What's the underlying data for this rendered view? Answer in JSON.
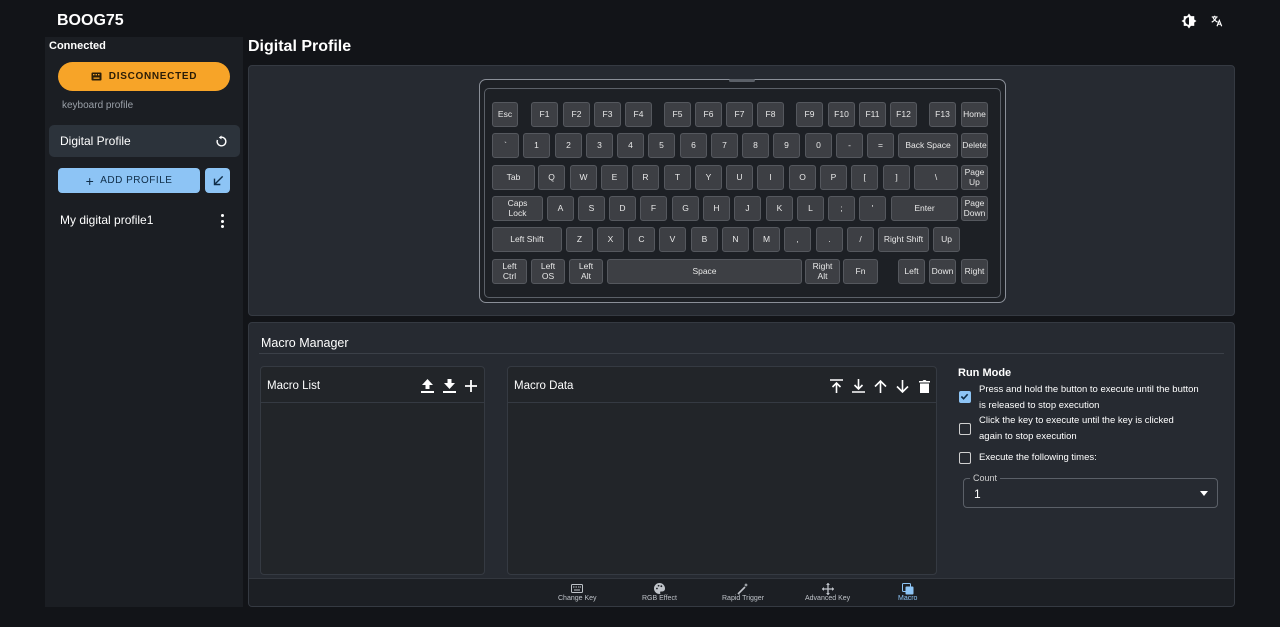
{
  "app": {
    "title": "BOOG75",
    "theme_icon": "brightness-icon",
    "language_icon": "translate-icon"
  },
  "sidebar": {
    "status": "Connected",
    "disconnect_label": "DISCONNECTED",
    "section_label": "keyboard profile",
    "active_profile": "Digital Profile",
    "add_profile_label": "ADD PROFILE",
    "profiles": [
      {
        "name": "My digital profile1"
      }
    ]
  },
  "main": {
    "title": "Digital Profile"
  },
  "keyboard": {
    "keys": [
      "Esc",
      "F1",
      "F2",
      "F3",
      "F4",
      "F5",
      "F6",
      "F7",
      "F8",
      "F9",
      "F10",
      "F11",
      "F12",
      "F13",
      "Home",
      "`",
      "1",
      "2",
      "3",
      "4",
      "5",
      "6",
      "7",
      "8",
      "9",
      "0",
      "-",
      "=",
      "Back Space",
      "Delete",
      "Tab",
      "Q",
      "W",
      "E",
      "R",
      "T",
      "Y",
      "U",
      "I",
      "O",
      "P",
      "[",
      "]",
      "\\",
      "Page\nUp",
      "Caps\nLock",
      "A",
      "S",
      "D",
      "F",
      "G",
      "H",
      "J",
      "K",
      "L",
      ";",
      "'",
      "Enter",
      "Page\nDown",
      "Left Shift",
      "Z",
      "X",
      "C",
      "V",
      "B",
      "N",
      "M",
      ",",
      ".",
      "/",
      "Right Shift",
      "Up",
      "Left\nCtrl",
      "Left\nOS",
      "Left\nAlt",
      "Space",
      "Right\nAlt",
      "Fn",
      "Left",
      "Down",
      "Right"
    ]
  },
  "macro": {
    "title": "Macro Manager",
    "list_title": "Macro List",
    "data_title": "Macro Data",
    "run_mode_title": "Run Mode",
    "options": [
      {
        "label": "Press and hold the button to execute until the button is released to stop execution",
        "checked": true
      },
      {
        "label": "Click the key to execute until the key is clicked again to stop execution",
        "checked": false
      },
      {
        "label": "Execute the following times:",
        "checked": false
      }
    ],
    "count_label": "Count",
    "count_value": "1"
  },
  "bottom_nav": {
    "items": [
      {
        "label": "Change Key",
        "icon": "keyboard-icon"
      },
      {
        "label": "RGB Effect",
        "icon": "palette-icon"
      },
      {
        "label": "Rapid Trigger",
        "icon": "magic-wand-icon"
      },
      {
        "label": "Advanced Key",
        "icon": "move-icon"
      },
      {
        "label": "Macro",
        "icon": "layers-icon",
        "active": true
      }
    ]
  },
  "colors": {
    "accent": "#8dc4f5",
    "warning": "#f7a428",
    "panel": "#262a31",
    "background": "#121418"
  }
}
